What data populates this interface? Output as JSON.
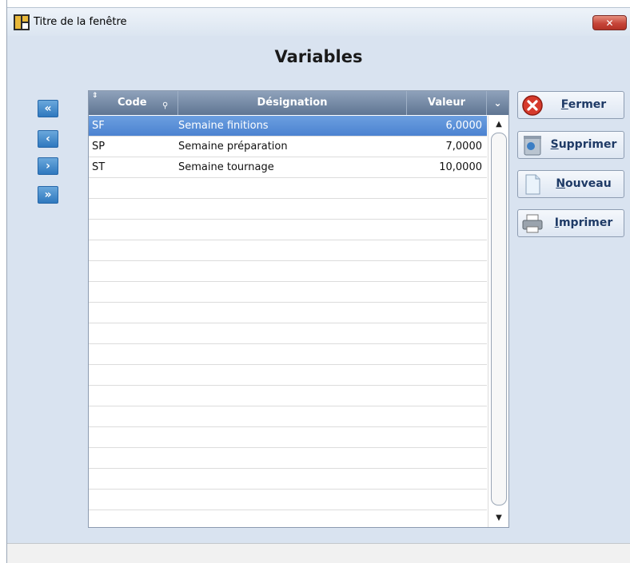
{
  "window": {
    "title": "Titre de la fenêtre",
    "close_label": "✕"
  },
  "page": {
    "title": "Variables"
  },
  "nav": [
    {
      "name": "first",
      "label": "«"
    },
    {
      "name": "prev",
      "label": "‹"
    },
    {
      "name": "next",
      "label": "›"
    },
    {
      "name": "last",
      "label": "»"
    }
  ],
  "table": {
    "headers": {
      "code": "Code",
      "designation": "Désignation",
      "value": "Valeur"
    },
    "rows": [
      {
        "code": "SF",
        "designation": "Semaine finitions",
        "value": "6,0000"
      },
      {
        "code": "SP",
        "designation": "Semaine préparation",
        "value": "7,0000"
      },
      {
        "code": "ST",
        "designation": "Semaine tournage",
        "value": "10,0000"
      }
    ],
    "selected_row": 0
  },
  "buttons": {
    "close": {
      "accel": "F",
      "rest": "ermer"
    },
    "delete": {
      "accel": "S",
      "rest": "upprimer"
    },
    "new": {
      "accel": "N",
      "rest": "ouveau"
    },
    "print": {
      "accel": "I",
      "rest": "mprimer"
    }
  },
  "colors": {
    "accent": "#4b82d0",
    "background": "#d9e3f0",
    "header": "#5f7592"
  }
}
